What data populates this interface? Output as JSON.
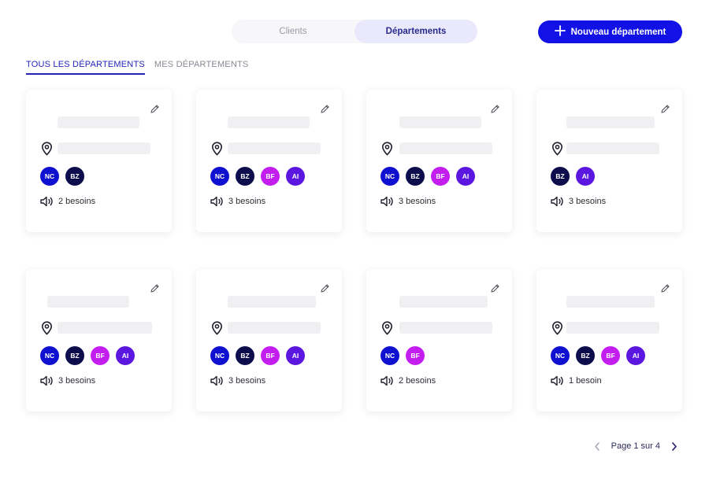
{
  "view_switch": {
    "clients_label": "Clients",
    "departments_label": "Départements",
    "active": "Départements"
  },
  "new_button": {
    "label": "Nouveau département",
    "icon": "plus-icon"
  },
  "filters": [
    {
      "label": "TOUS LES DÉPARTEMENTS",
      "active": true
    },
    {
      "label": "MES DÉPARTEMENTS",
      "active": false
    }
  ],
  "avatar_colors": {
    "NC": "#1010d0",
    "BZ": "#0d0d4d",
    "BF": "#c41df0",
    "AI": "#5b16e0"
  },
  "cards": [
    {
      "avatars": [
        "NC",
        "BZ"
      ],
      "needs": "2 besoins"
    },
    {
      "avatars": [
        "NC",
        "BZ",
        "BF",
        "AI"
      ],
      "needs": "3 besoins"
    },
    {
      "avatars": [
        "NC",
        "BZ",
        "BF",
        "AI"
      ],
      "needs": "3 besoins"
    },
    {
      "avatars": [
        "BZ",
        "AI"
      ],
      "needs": "3 besoins"
    },
    {
      "avatars": [
        "NC",
        "BZ",
        "BF",
        "AI"
      ],
      "needs": "3 besoins"
    },
    {
      "avatars": [
        "NC",
        "BZ",
        "BF",
        "AI"
      ],
      "needs": "3 besoins"
    },
    {
      "avatars": [
        "NC",
        "BF"
      ],
      "needs": "2 besoins"
    },
    {
      "avatars": [
        "NC",
        "BZ",
        "BF",
        "AI"
      ],
      "needs": "1 besoin"
    }
  ],
  "card_icons": {
    "edit": "pencil-icon",
    "location": "map-pin-icon",
    "needs": "megaphone-icon"
  },
  "pagination": {
    "label": "Page 1 sur 4",
    "prev_icon": "chevron-left-icon",
    "next_icon": "chevron-right-icon"
  }
}
